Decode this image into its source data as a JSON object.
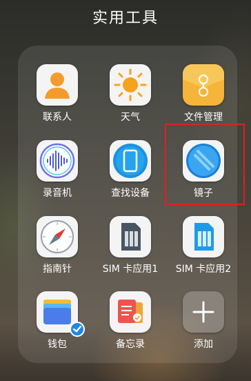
{
  "folder": {
    "title": "实用工具"
  },
  "apps": [
    {
      "label": "联系人",
      "icon": "contacts-icon"
    },
    {
      "label": "天气",
      "icon": "weather-sun-icon"
    },
    {
      "label": "文件管理",
      "icon": "file-folder-icon"
    },
    {
      "label": "录音机",
      "icon": "recorder-waveform-icon"
    },
    {
      "label": "查找设备",
      "icon": "find-device-phone-icon"
    },
    {
      "label": "镜子",
      "icon": "mirror-icon"
    },
    {
      "label": "指南针",
      "icon": "compass-icon"
    },
    {
      "label": "SIM 卡应用1",
      "icon": "sim-card-icon"
    },
    {
      "label": "SIM 卡应用2",
      "icon": "sim-card-icon"
    },
    {
      "label": "钱包",
      "icon": "wallet-icon"
    },
    {
      "label": "备忘录",
      "icon": "notes-icon"
    },
    {
      "label": "添加",
      "icon": "plus-icon"
    }
  ],
  "highlight": {
    "target": "镜子",
    "color": "#e0201c"
  }
}
